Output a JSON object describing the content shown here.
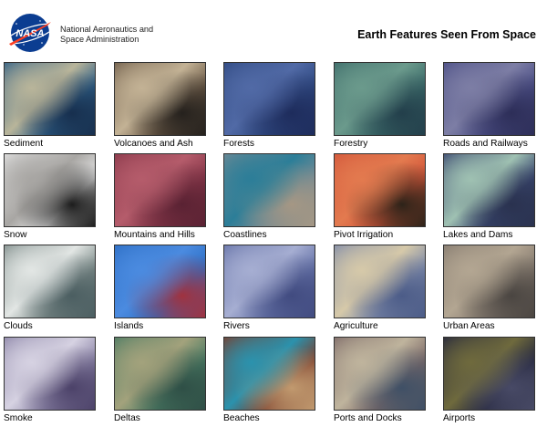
{
  "header": {
    "logo_text": "NASA",
    "agency_line1": "National Aeronautics and",
    "agency_line2": "Space Administration",
    "title": "Earth Features Seen From Space"
  },
  "features": [
    {
      "label": "Sediment",
      "colors": [
        "#2f5f86",
        "#b9b59a",
        "#172f4e"
      ]
    },
    {
      "label": "Volcanoes and Ash",
      "colors": [
        "#6e5c49",
        "#c3b295",
        "#25211d"
      ]
    },
    {
      "label": "Forests",
      "colors": [
        "#304a82",
        "#516aa6",
        "#1e2c5c"
      ]
    },
    {
      "label": "Forestry",
      "colors": [
        "#3d6c6a",
        "#6b9a8c",
        "#233f4b"
      ]
    },
    {
      "label": "Roads and Railways",
      "colors": [
        "#4c4f86",
        "#7d7ea5",
        "#2d2e58"
      ]
    },
    {
      "label": "Snow",
      "colors": [
        "#e2e2e2",
        "#a8a6a3",
        "#1d1d1d"
      ]
    },
    {
      "label": "Mountains and Hills",
      "colors": [
        "#89384a",
        "#b55c6b",
        "#5a2233"
      ]
    },
    {
      "label": "Coastlines",
      "colors": [
        "#6f8994",
        "#2c7e98",
        "#a59784"
      ]
    },
    {
      "label": "Pivot Irrigation",
      "colors": [
        "#d2563a",
        "#e37a4f",
        "#2d2319"
      ]
    },
    {
      "label": "Lakes and Dams",
      "colors": [
        "#39466f",
        "#9fc1b2",
        "#2a324f"
      ]
    },
    {
      "label": "Clouds",
      "colors": [
        "#7e8c8a",
        "#e2e6e4",
        "#4b5e61"
      ]
    },
    {
      "label": "Islands",
      "colors": [
        "#2c6ec4",
        "#4b8be0",
        "#a0323f"
      ]
    },
    {
      "label": "Rivers",
      "colors": [
        "#6673a8",
        "#a6aed2",
        "#414b80"
      ]
    },
    {
      "label": "Agriculture",
      "colors": [
        "#7e8aa9",
        "#d6c9a9",
        "#4c5c88"
      ]
    },
    {
      "label": "Urban Areas",
      "colors": [
        "#857a6f",
        "#b3a692",
        "#4a4541"
      ]
    },
    {
      "label": "Smoke",
      "colors": [
        "#8d86a8",
        "#d6d2e2",
        "#4c4269"
      ]
    },
    {
      "label": "Deltas",
      "colors": [
        "#4a7a63",
        "#a3a27c",
        "#2f4f46"
      ]
    },
    {
      "label": "Beaches",
      "colors": [
        "#7a3d2c",
        "#2b92ad",
        "#c19a6f"
      ]
    },
    {
      "label": "Ports and Docks",
      "colors": [
        "#7d6a68",
        "#bfb49d",
        "#3f5066"
      ]
    },
    {
      "label": "Airports",
      "colors": [
        "#25273d",
        "#6f6a3d",
        "#484a66"
      ]
    }
  ]
}
